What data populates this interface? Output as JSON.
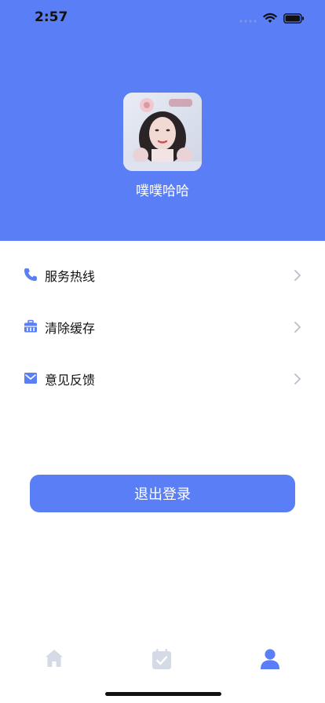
{
  "status_bar": {
    "time": "2:57"
  },
  "profile": {
    "username": "噗噗哈哈"
  },
  "menu": {
    "items": [
      {
        "label": "服务热线",
        "icon": "phone-icon"
      },
      {
        "label": "清除缓存",
        "icon": "briefcase-icon"
      },
      {
        "label": "意见反馈",
        "icon": "mail-icon"
      }
    ]
  },
  "actions": {
    "logout_label": "退出登录"
  },
  "tabs": [
    {
      "icon": "home-icon",
      "active": false
    },
    {
      "icon": "calendar-check-icon",
      "active": false
    },
    {
      "icon": "person-icon",
      "active": true
    }
  ],
  "colors": {
    "accent": "#5a7ef5",
    "inactive_tab": "#d5dbe6",
    "chevron": "#b8bfcc"
  }
}
